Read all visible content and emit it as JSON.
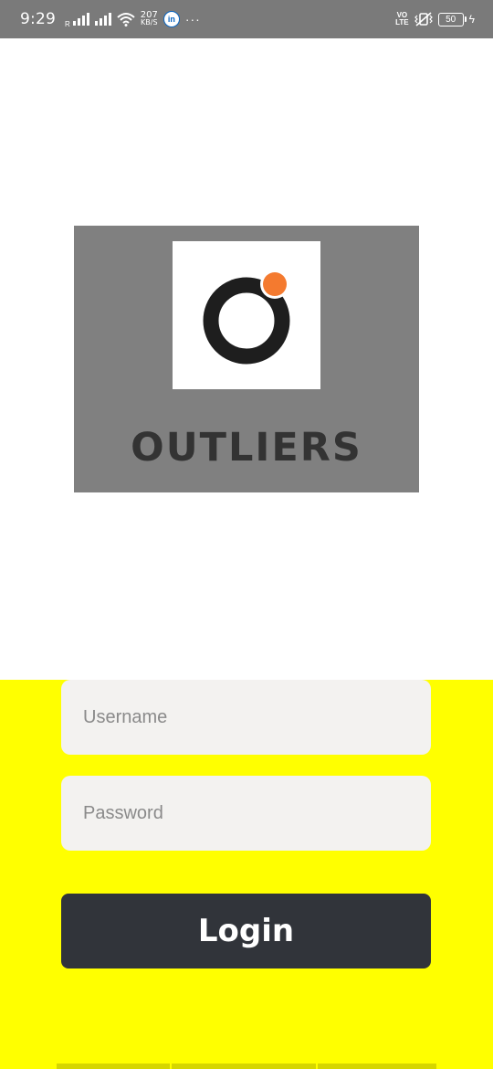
{
  "status_bar": {
    "time": "9:29",
    "roaming_label": "R",
    "network_speed_value": "207",
    "network_speed_unit": "KB/S",
    "linkedin_badge": "in",
    "more_dots": "···",
    "volte_top": "VO",
    "volte_bottom": "LTE",
    "battery_level": "50",
    "icons": [
      "signal-icon",
      "wifi-icon",
      "linkedin-icon",
      "volte-icon",
      "vibrate-icon",
      "battery-icon",
      "charging-icon"
    ]
  },
  "logo": {
    "brand_name": "OUTLIERS",
    "ring_color": "#1e1e1e",
    "dot_color": "#f47a2f"
  },
  "login_form": {
    "username_placeholder": "Username",
    "username_value": "",
    "password_placeholder": "Password",
    "password_value": "",
    "login_label": "Login"
  },
  "colors": {
    "status_bar": "#7a7a7a",
    "logo_panel": "#808080",
    "form_background": "#ffff00",
    "field_background": "#f3f2f0",
    "button_background": "#31343a"
  }
}
